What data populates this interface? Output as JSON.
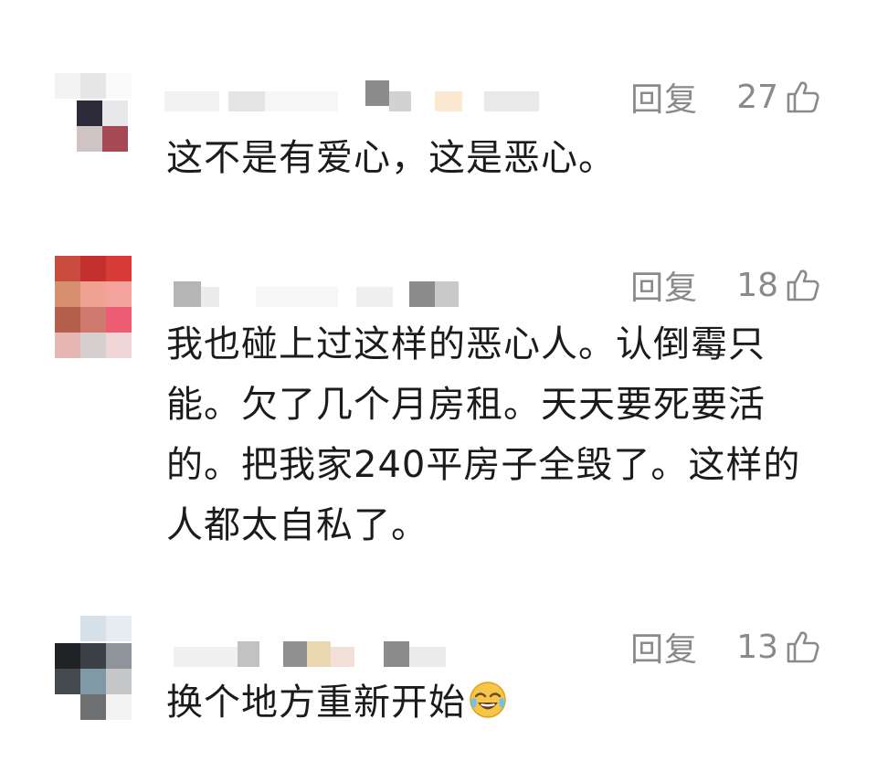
{
  "comments": [
    {
      "reply_label": "回复",
      "like_count": "27",
      "text": "这不是有爱心，这是恶心。"
    },
    {
      "reply_label": "回复",
      "like_count": "18",
      "text": "我也碰上过这样的恶心人。认倒霉只能。欠了几个月房租。天天要死要活的。把我家240平房子全毁了。这样的人都太自私了。"
    },
    {
      "reply_label": "回复",
      "like_count": "13",
      "text": "换个地方重新开始"
    }
  ],
  "icons": {
    "like": "thumbs-up-icon",
    "emoji": "laughing-crying-emoji-icon"
  }
}
